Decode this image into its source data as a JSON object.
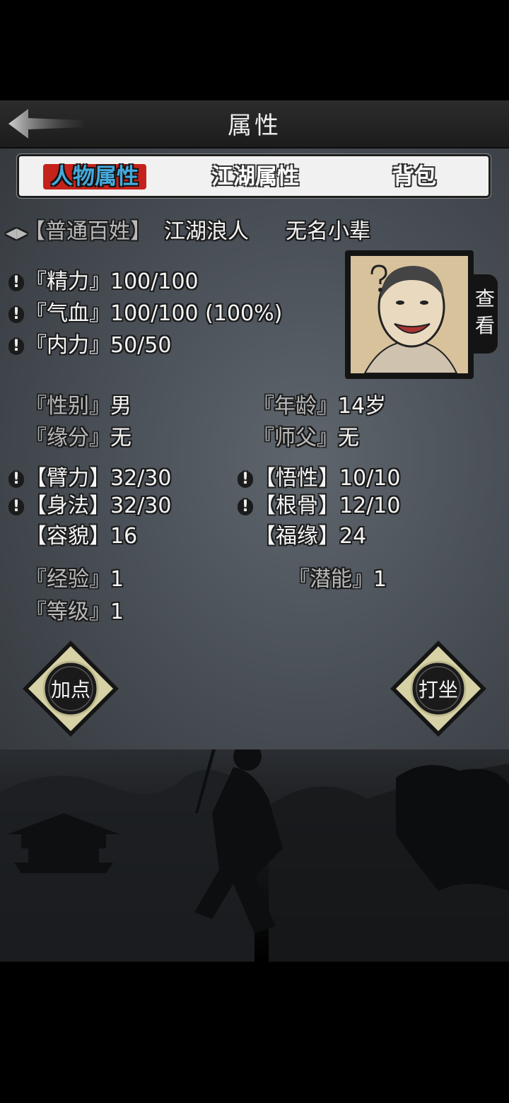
{
  "header": {
    "title": "属性"
  },
  "tabs": [
    {
      "label": "人物属性",
      "active": true
    },
    {
      "label": "江湖属性",
      "active": false
    },
    {
      "label": "背包",
      "active": false
    }
  ],
  "identity": {
    "class": "【普通百姓】",
    "title1": "江湖浪人",
    "title2": "无名小辈"
  },
  "vitals": [
    {
      "label": "『精力』",
      "value": "100/100"
    },
    {
      "label": "『气血』",
      "value": "100/100 (100%)"
    },
    {
      "label": "『内力』",
      "value": "50/50"
    }
  ],
  "portrait": {
    "view_label": "查看"
  },
  "info": {
    "gender_label": "『性别』",
    "gender": "男",
    "age_label": "『年龄』",
    "age": "14岁",
    "fate_label": "『缘分』",
    "fate": "无",
    "master_label": "『师父』",
    "master": "无"
  },
  "attrs": {
    "strength_label": "【臂力】",
    "strength": "32/30",
    "insight_label": "【悟性】",
    "insight": "10/10",
    "agility_label": "【身法】",
    "agility": "32/30",
    "bone_label": "【根骨】",
    "bone": "12/10",
    "looks_label": "【容貌】",
    "looks": "16",
    "luck_label": "【福缘】",
    "luck": "24"
  },
  "progress": {
    "exp_label": "『经验』",
    "exp": "1",
    "potential_label": "『潜能』",
    "potential": "1",
    "level_label": "『等级』",
    "level": "1"
  },
  "buttons": {
    "add_points": "加点",
    "meditate": "打坐"
  },
  "colors": {
    "active_tab_bg": "#c4221b",
    "active_tab_text": "#44aadd",
    "panel_bg": "#4a5057"
  }
}
